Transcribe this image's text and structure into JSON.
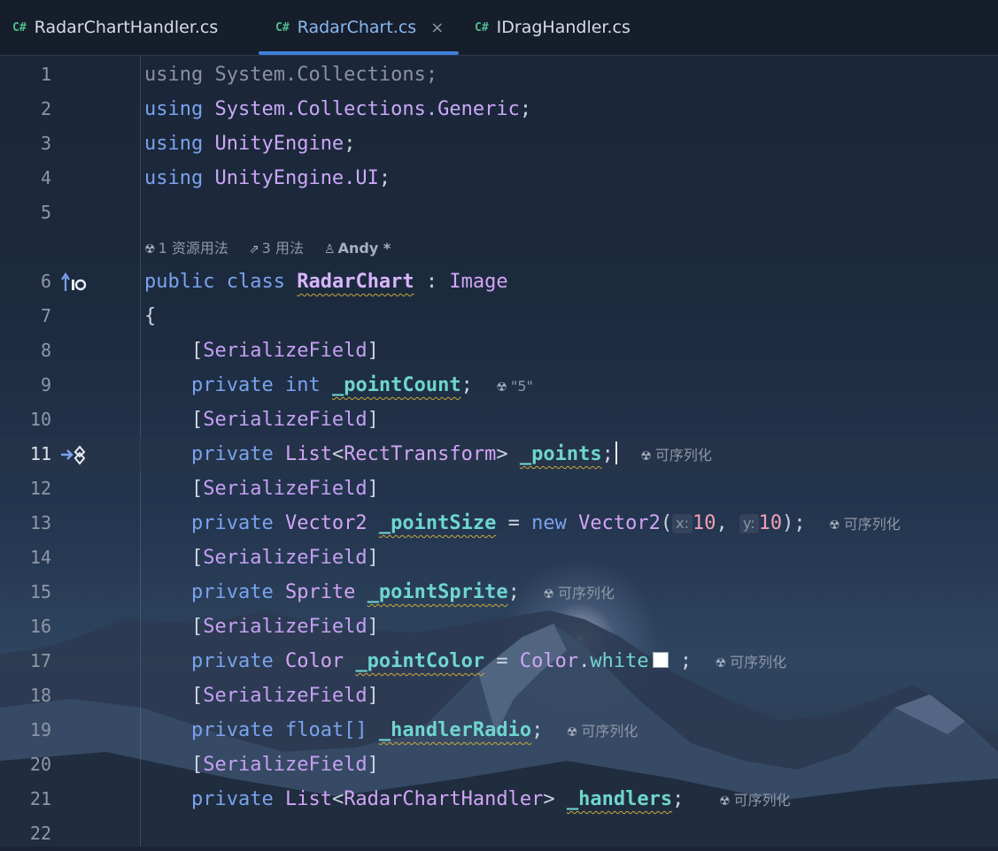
{
  "tabs": [
    {
      "icon": "C#",
      "label": "RadarChartHandler.cs",
      "active": false
    },
    {
      "icon": "C#",
      "label": "RadarChart.cs",
      "active": true,
      "close": "×"
    },
    {
      "icon": "C#",
      "label": "IDragHandler.cs",
      "active": false
    }
  ],
  "colors": {
    "accent": "#3d7edb",
    "keyword": "#7aa3ee",
    "type": "#d2a5f5",
    "field": "#6fd5cf",
    "number": "#f29fb4"
  },
  "icons": {
    "csharp_file": "csharp-file-icon",
    "unity": "unity-icon",
    "user": "user-icon",
    "usages": "usages-icon",
    "implements": "implements-icon",
    "override": "override-icon"
  },
  "editor": {
    "line_numbers": [
      "1",
      "2",
      "3",
      "4",
      "5",
      "6",
      "7",
      "8",
      "9",
      "10",
      "11",
      "12",
      "13",
      "14",
      "15",
      "16",
      "17",
      "18",
      "19",
      "20",
      "21",
      "22"
    ],
    "current_line": "11",
    "code_lens": {
      "resource_usages": "1 资源用法",
      "usages": "3 用法",
      "author": "Andy *"
    },
    "lines": {
      "l1": {
        "kw": "using",
        "ns": "System.Collections",
        "end": ";"
      },
      "l2": {
        "kw": "using",
        "ns": "System.Collections.Generic",
        "end": ";"
      },
      "l3": {
        "kw": "using",
        "ns": "UnityEngine",
        "end": ";"
      },
      "l4": {
        "kw": "using",
        "ns": "UnityEngine.UI",
        "end": ";"
      },
      "l6": {
        "kw1": "public",
        "kw2": "class",
        "name": "RadarChart",
        "colon": ":",
        "base": "Image"
      },
      "l7": {
        "text": "{"
      },
      "attr": {
        "open": "[",
        "name": "SerializeField",
        "close": "]"
      },
      "l9": {
        "kw": "private",
        "type": "int",
        "field": "_pointCount",
        "end": ";",
        "inlay": "\"5\""
      },
      "l11": {
        "kw": "private",
        "type": "List",
        "lt": "<",
        "arg": "RectTransform",
        "gt": ">",
        "field": "_points",
        "end": ";",
        "inlay": "可序列化"
      },
      "l13": {
        "kw": "private",
        "type": "Vector2",
        "field": "_pointSize",
        "eq": "=",
        "new": "new",
        "ctor": "Vector2",
        "open": "(",
        "hint_x": "x:",
        "x": "10",
        "comma": ",",
        "hint_y": "y:",
        "y": "10",
        "end": ");",
        "inlay": "可序列化"
      },
      "l15": {
        "kw": "private",
        "type": "Sprite",
        "field": "_pointSprite",
        "end": ";",
        "inlay": "可序列化"
      },
      "l17": {
        "kw": "private",
        "type": "Color",
        "field": "_pointColor",
        "eq": "=",
        "cls": "Color",
        "dot": ".",
        "prop": "white",
        "end": ";",
        "inlay": "可序列化"
      },
      "l19": {
        "kw": "private",
        "type": "float[]",
        "field": "_handlerRadio",
        "end": ";",
        "inlay": "可序列化"
      },
      "l21": {
        "kw": "private",
        "type": "List",
        "lt": "<",
        "arg": "RadarChartHandler",
        "gt": ">",
        "field": "_handlers",
        "end": ";",
        "inlay": "可序列化"
      }
    }
  }
}
